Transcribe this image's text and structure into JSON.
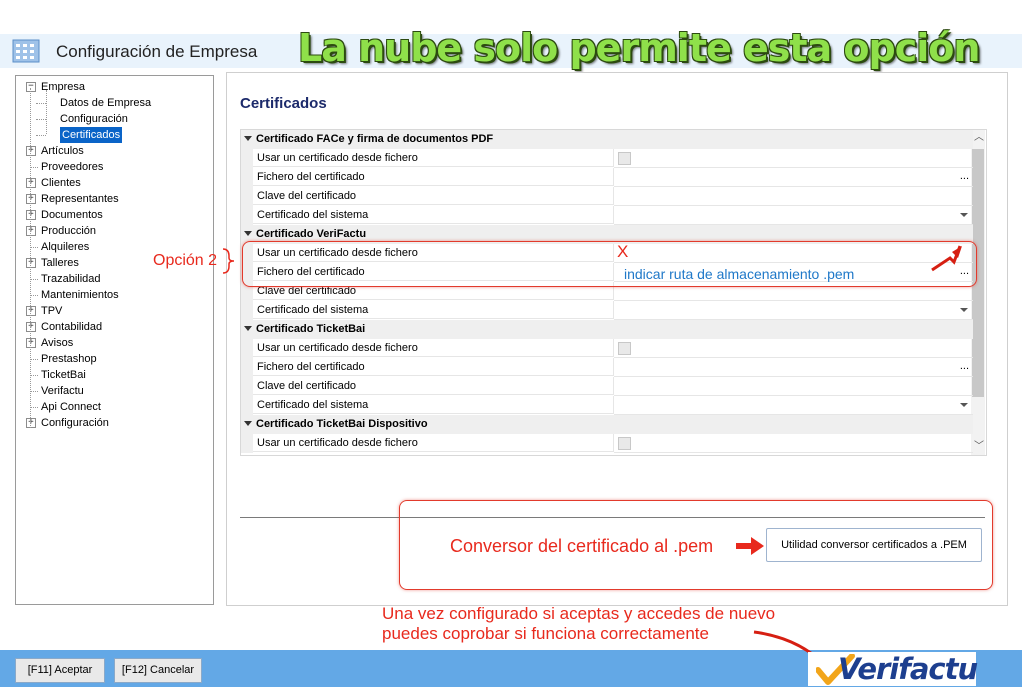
{
  "window": {
    "title": "Configuración de Empresa",
    "banner": "La nube solo permite esta opción"
  },
  "tree": {
    "items": [
      {
        "label": "Empresa",
        "expander": "−"
      },
      {
        "label": "Datos de Empresa"
      },
      {
        "label": "Configuración"
      },
      {
        "label": "Certificados",
        "selected": true
      },
      {
        "label": "Artículos",
        "expander": "+"
      },
      {
        "label": "Proveedores"
      },
      {
        "label": "Clientes",
        "expander": "+"
      },
      {
        "label": "Representantes",
        "expander": "+"
      },
      {
        "label": "Documentos",
        "expander": "+"
      },
      {
        "label": "Producción",
        "expander": "+"
      },
      {
        "label": "Alquileres"
      },
      {
        "label": "Talleres",
        "expander": "+"
      },
      {
        "label": "Trazabilidad"
      },
      {
        "label": "Mantenimientos"
      },
      {
        "label": "TPV",
        "expander": "+"
      },
      {
        "label": "Contabilidad",
        "expander": "+"
      },
      {
        "label": "Avisos",
        "expander": "+"
      },
      {
        "label": "Prestashop"
      },
      {
        "label": "TicketBai"
      },
      {
        "label": "Verifactu"
      },
      {
        "label": "Api Connect"
      },
      {
        "label": "Configuración",
        "expander": "+"
      }
    ]
  },
  "main": {
    "section_title": "Certificados",
    "groups": [
      {
        "label": "Certificado FACe y firma de documentos PDF",
        "rows": [
          {
            "label": "Usar un certificado desde fichero",
            "editor": "checkbox"
          },
          {
            "label": "Fichero del certificado",
            "editor": "ellipsis",
            "ellipsis": "..."
          },
          {
            "label": "Clave del certificado",
            "editor": "text"
          },
          {
            "label": "Certificado del sistema",
            "editor": "dropdown"
          }
        ]
      },
      {
        "label": "Certificado VeriFactu",
        "rows": [
          {
            "label": "Usar un certificado desde fichero",
            "editor": "checkbox-x",
            "mark": "X"
          },
          {
            "label": "Fichero del certificado",
            "editor": "ellipsis",
            "ellipsis": "..."
          },
          {
            "label": "Clave del certificado",
            "editor": "text"
          },
          {
            "label": "Certificado del sistema",
            "editor": "dropdown"
          }
        ]
      },
      {
        "label": "Certificado TicketBai",
        "rows": [
          {
            "label": "Usar un certificado desde fichero",
            "editor": "checkbox"
          },
          {
            "label": "Fichero del certificado",
            "editor": "ellipsis",
            "ellipsis": "..."
          },
          {
            "label": "Clave del certificado",
            "editor": "text"
          },
          {
            "label": "Certificado del sistema",
            "editor": "dropdown"
          }
        ]
      },
      {
        "label": "Certificado TicketBai Dispositivo",
        "rows": [
          {
            "label": "Usar un certificado desde fichero",
            "editor": "checkbox"
          }
        ]
      }
    ],
    "converter_button": "Utilidad conversor certificados a .PEM"
  },
  "annotations": {
    "option2": "Opción 2",
    "path_hint": "indicar ruta de almacenamiento .pem",
    "converter_note": "Conversor del certificado al .pem",
    "final_note_line1": "Una vez configurado si aceptas y accedes de nuevo",
    "final_note_line2": "puedes coprobar si funciona correctamente",
    "logo_text": "Verifactu",
    "accent_red": "#e8291d",
    "accent_blue": "#1f78c8"
  },
  "footer": {
    "accept": "[F11] Aceptar",
    "cancel": "[F12] Cancelar"
  }
}
